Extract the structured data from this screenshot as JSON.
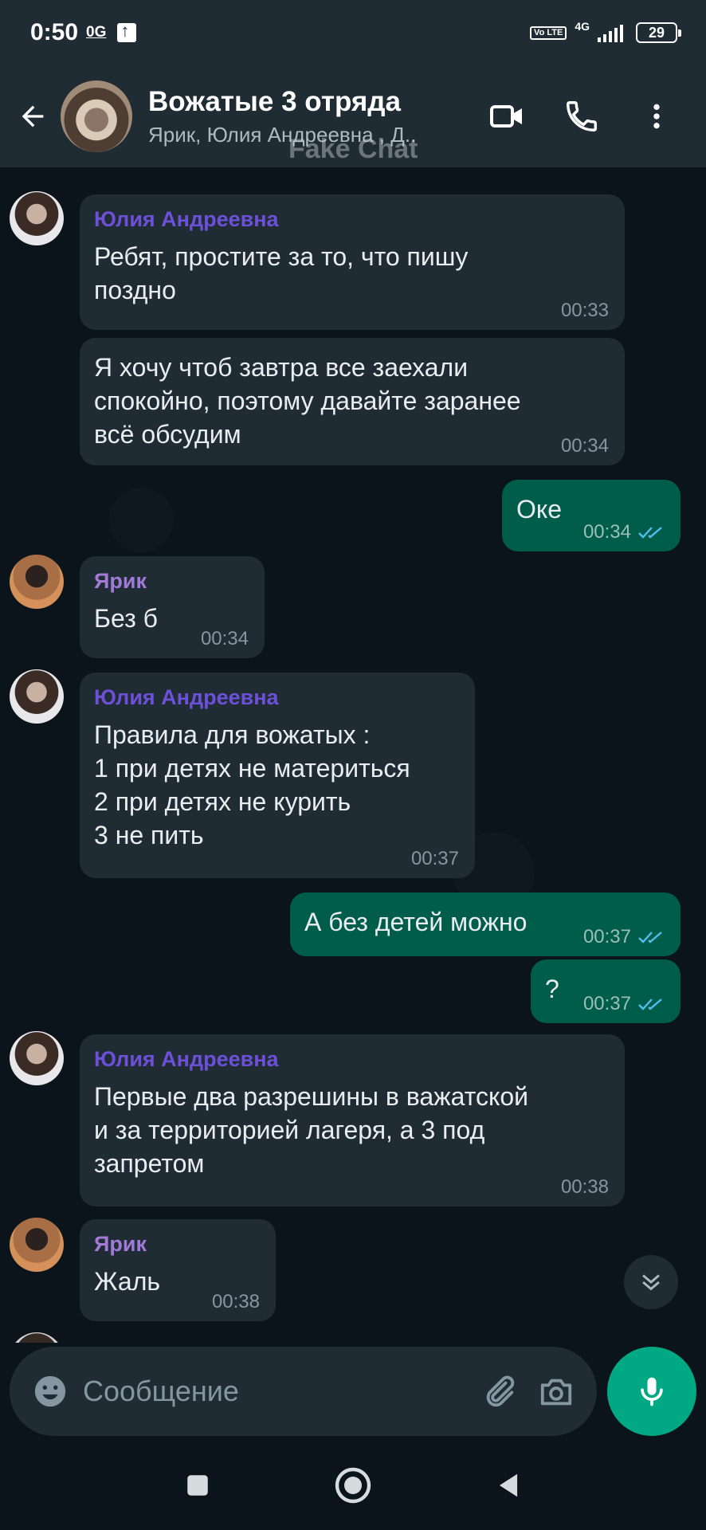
{
  "status_bar": {
    "time": "0:50",
    "badge": "0G",
    "volte": "Vo LTE",
    "network": "4G",
    "battery": "29"
  },
  "header": {
    "title": "Вожатые 3 отряда",
    "subtitle": "Ярик, Юлия Андреевна , Д..",
    "watermark": "Fake Chat"
  },
  "messages": [
    {
      "sender": "Юлия Андреевна",
      "text": "Ребят, простите за то, что пишу\nпоздно",
      "time": "00:33"
    },
    {
      "text": "Я хочу чтоб завтра все заехали\nспокойно, поэтому давайте заранее\nвсё обсудим",
      "time": "00:34"
    },
    {
      "text": "Оке",
      "time": "00:34"
    },
    {
      "sender": "Ярик",
      "text": "Без б",
      "time": "00:34"
    },
    {
      "sender": "Юлия Андреевна",
      "text": "Правила для вожатых :\n1 при детях не материться\n2  при детях не курить\n3 не пить",
      "time": "00:37"
    },
    {
      "text": "А без детей можно",
      "time": "00:37"
    },
    {
      "text": "?",
      "time": "00:37"
    },
    {
      "sender": "Юлия Андреевна",
      "text": "Первые два разрешины в важатской\nи за территорией лагеря, а 3 под\nзапретом",
      "time": "00:38"
    },
    {
      "sender": "Ярик",
      "text": "Жаль",
      "time": "00:38"
    }
  ],
  "composer": {
    "placeholder": "Сообщение"
  },
  "colors": {
    "background": "#0b141a",
    "header": "#1f2c34",
    "incoming_bubble": "#1f2c34",
    "outgoing_bubble": "#005c4b",
    "accent": "#00a884",
    "read_ticks": "#53bdeb"
  },
  "icons": [
    "back-arrow-icon",
    "video-call-icon",
    "phone-icon",
    "more-vertical-icon",
    "emoji-icon",
    "attach-icon",
    "camera-icon",
    "mic-icon",
    "chevron-down-icon",
    "nav-square-icon",
    "nav-circle-icon",
    "nav-triangle-icon"
  ]
}
